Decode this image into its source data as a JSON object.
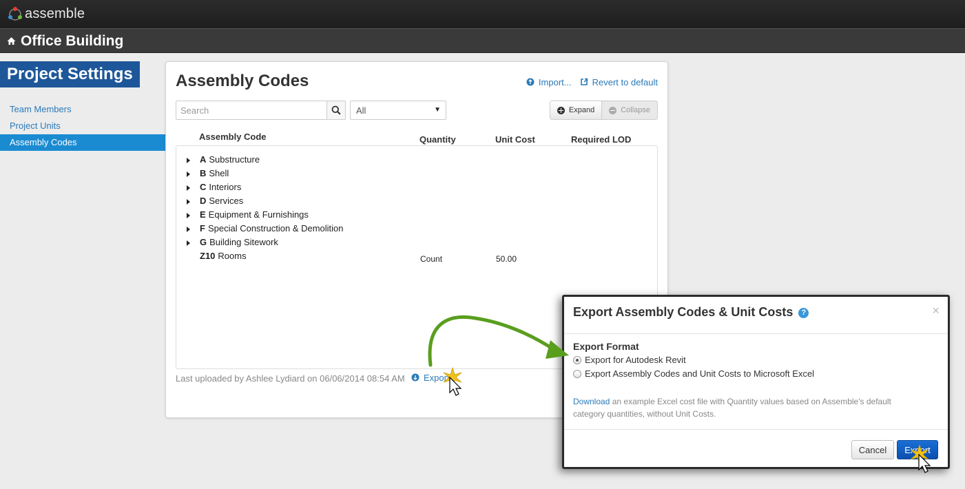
{
  "app": {
    "name": "assemble"
  },
  "project": {
    "title": "Office Building"
  },
  "sidebar": {
    "heading": "Project Settings",
    "items": [
      {
        "label": "Team Members",
        "active": false
      },
      {
        "label": "Project Units",
        "active": false
      },
      {
        "label": "Assembly Codes",
        "active": true
      }
    ]
  },
  "panel": {
    "title": "Assembly Codes",
    "import_label": "Import...",
    "revert_label": "Revert to default",
    "search_placeholder": "Search",
    "filter_selected": "All",
    "expand_label": "Expand",
    "collapse_label": "Collapse",
    "columns": {
      "code": "Assembly Code",
      "quantity": "Quantity",
      "unit_cost": "Unit Cost",
      "lod": "Required LOD"
    },
    "rows": [
      {
        "code": "A",
        "name": "Substructure",
        "quantity": "",
        "unit_cost": ""
      },
      {
        "code": "B",
        "name": "Shell",
        "quantity": "",
        "unit_cost": ""
      },
      {
        "code": "C",
        "name": "Interiors",
        "quantity": "",
        "unit_cost": ""
      },
      {
        "code": "D",
        "name": "Services",
        "quantity": "",
        "unit_cost": ""
      },
      {
        "code": "E",
        "name": "Equipment & Furnishings",
        "quantity": "",
        "unit_cost": ""
      },
      {
        "code": "F",
        "name": "Special Construction & Demolition",
        "quantity": "",
        "unit_cost": ""
      },
      {
        "code": "G",
        "name": "Building Sitework",
        "quantity": "",
        "unit_cost": ""
      },
      {
        "code": "Z10",
        "name": "Rooms",
        "quantity": "Count",
        "unit_cost": "50.00"
      }
    ],
    "last_uploaded": "Last uploaded by Ashlee Lydiard on 06/06/2014 08:54 AM",
    "export_link": "Export"
  },
  "dialog": {
    "title": "Export Assembly Codes & Unit Costs",
    "help_glyph": "?",
    "close_glyph": "×",
    "format_heading": "Export Format",
    "options": [
      {
        "label": "Export for Autodesk Revit",
        "selected": true
      },
      {
        "label": "Export Assembly Codes and Unit Costs to Microsoft Excel",
        "selected": false
      }
    ],
    "download_link": "Download",
    "description": " an example Excel cost file with Quantity values based on Assemble's default category quantities, without Unit Costs.",
    "cancel_label": "Cancel",
    "export_label": "Export"
  },
  "colors": {
    "accent": "#1b8bd1",
    "heading_bg": "#1e5799",
    "link": "#2a7ab8",
    "arrow": "#5a9e1e"
  }
}
